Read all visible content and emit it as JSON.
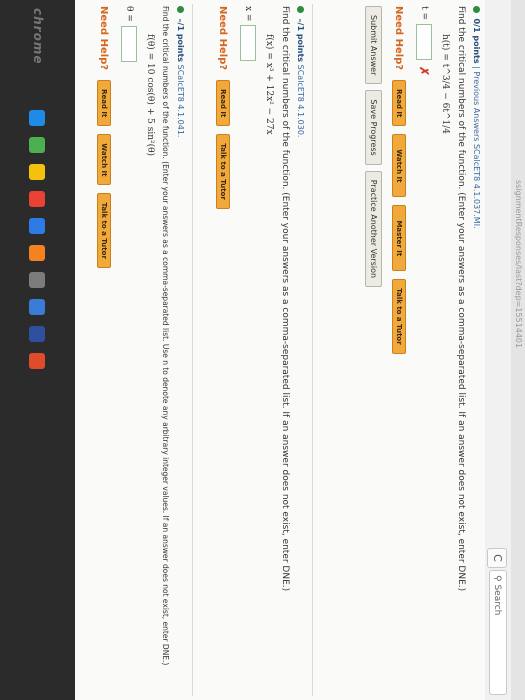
{
  "browser": {
    "url_text": "ssignmentResponses/last?dep=15514401",
    "search_placeholder": "Search",
    "refresh_glyph": "C"
  },
  "q1": {
    "points": "0/1 points",
    "link_prev": "Previous Answers",
    "ref": "SCalcET8 4.1.037.MI.",
    "prompt": "Find the critical numbers of the function. (Enter your answers as a comma-separated list. If an answer does not exist, enter DNE.)",
    "formula": "h(t) = t^3/4 − 6t^1/4",
    "answer_label": "t =",
    "wrong_mark": "✗"
  },
  "help": {
    "need_help": "Need Help?",
    "read": "Read It",
    "watch": "Watch It",
    "master": "Master It",
    "tutor": "Talk to a Tutor"
  },
  "actions": {
    "submit": "Submit Answer",
    "save": "Save Progress",
    "practice": "Practice Another Version"
  },
  "q2": {
    "points": "–/1 points",
    "ref": "SCalcET8 4.1.030.",
    "prompt": "Find the critical numbers of the function. (Enter your answers as a comma-separated list. If an answer does not exist, enter DNE.)",
    "formula": "f(x) = x³ + 12x² − 27x",
    "answer_label": "x ="
  },
  "q3": {
    "points": "–/1 points",
    "ref": "SCalcET8 4.1.041.",
    "prompt": "Find the critical numbers of the function. (Enter your answers as a comma-separated list. Use n to denote any arbitrary integer values. If an answer does not exist, enter DNE.)",
    "formula": "f(θ) = 10 cos(θ) + 5 sin²(θ)",
    "answer_label": "θ ="
  },
  "taskbar": {
    "brand": "chrome",
    "icon_colors": [
      "#1e8ce6",
      "#4caf50",
      "#f4c20d",
      "#e94235",
      "#2d7be5",
      "#f58220",
      "#7b7b7b",
      "#3a7bd5",
      "#2f4f9f",
      "#e04b2b"
    ]
  }
}
